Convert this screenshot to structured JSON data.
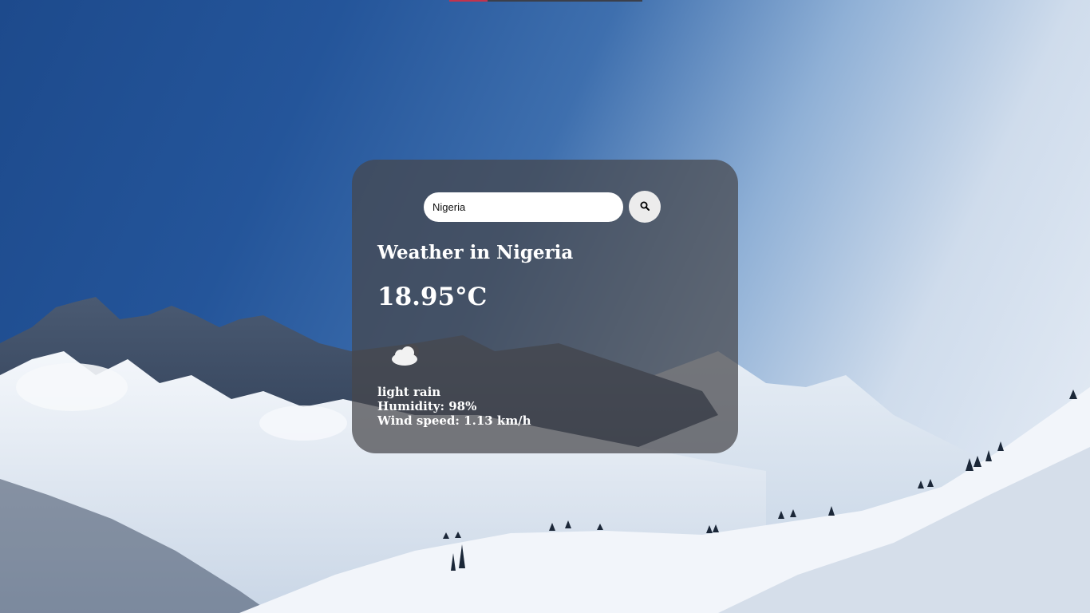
{
  "search": {
    "value": "Nigeria",
    "placeholder": "Search"
  },
  "weather": {
    "title": "Weather in Nigeria",
    "temperature": "18.95°C",
    "icon": "cloud-icon",
    "description": "light rain",
    "humidity": "Humidity: 98%",
    "wind": "Wind speed: 1.13 km/h"
  },
  "colors": {
    "card_background": "#46464b",
    "search_field": "#ffffff",
    "search_button": "#ececec",
    "text": "#ffffff"
  }
}
